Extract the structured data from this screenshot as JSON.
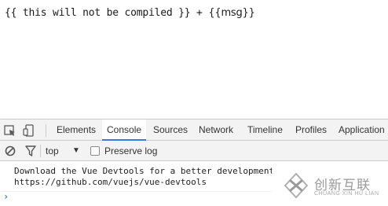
{
  "page": {
    "output_prefix": "{{ this will not be compiled }} + ",
    "output_template": "{{msg}}"
  },
  "devtools": {
    "tabs": [
      {
        "label": "Elements",
        "active": false
      },
      {
        "label": "Console",
        "active": true
      },
      {
        "label": "Sources",
        "active": false
      },
      {
        "label": "Network",
        "active": false
      },
      {
        "label": "Timeline",
        "active": false
      },
      {
        "label": "Profiles",
        "active": false
      },
      {
        "label": "Application",
        "active": false
      }
    ],
    "icons": [
      "inspect-icon",
      "device-toolbar-icon"
    ],
    "filterbar": {
      "context_label": "top",
      "preserve_log_label": "Preserve log",
      "preserve_log_checked": false
    },
    "console": {
      "messages": [
        {
          "line1": "Download the Vue Devtools for a better development",
          "line2": "https://github.com/vuejs/vue-devtools"
        }
      ],
      "prompt_symbol": "›"
    },
    "accent_color": "#3879d9"
  },
  "watermark": {
    "text_cn": "创新互联",
    "text_en": "CHUANG XIN HU LIAN"
  }
}
